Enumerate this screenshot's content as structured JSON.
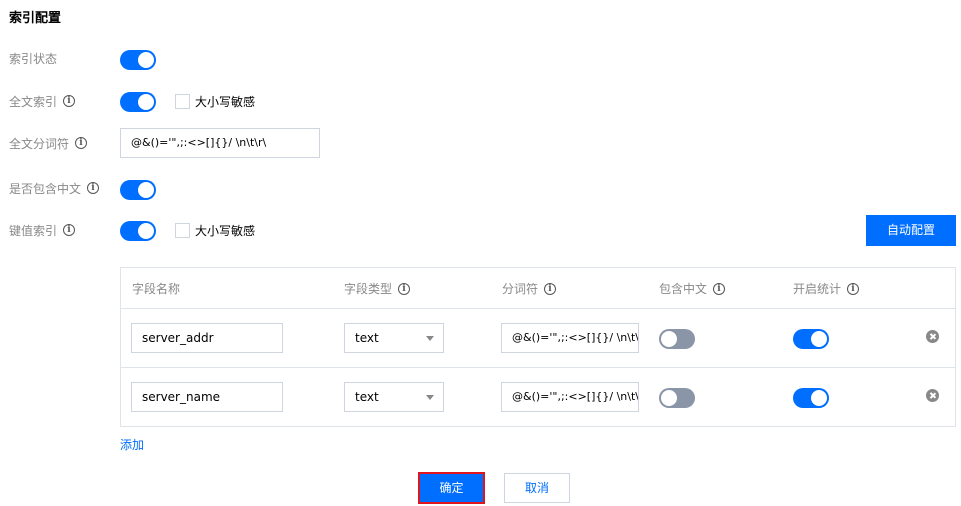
{
  "title": "索引配置",
  "form": {
    "index_status": {
      "label": "索引状态",
      "enabled": true
    },
    "fulltext_index": {
      "label": "全文索引",
      "enabled": true,
      "case_sensitive_label": "大小写敏感",
      "case_sensitive": false
    },
    "fulltext_delimiter": {
      "label": "全文分词符",
      "value": "@&()='\",;:<>[]{}/ \\n\\t\\r\\"
    },
    "include_chinese": {
      "label": "是否包含中文",
      "enabled": true
    },
    "kv_index": {
      "label": "键值索引",
      "enabled": true,
      "case_sensitive_label": "大小写敏感",
      "case_sensitive": false
    }
  },
  "auto_config_button": "自动配置",
  "table": {
    "headers": {
      "field_name": "字段名称",
      "field_type": "字段类型",
      "delimiter": "分词符",
      "include_chinese": "包含中文",
      "enable_stats": "开启统计"
    },
    "rows": [
      {
        "field_name": "server_addr",
        "field_type": "text",
        "delimiter": "@&()='\",;:<>[]{}/ \\n\\t\\r\\",
        "include_chinese": false,
        "enable_stats": true
      },
      {
        "field_name": "server_name",
        "field_type": "text",
        "delimiter": "@&()='\",;:<>[]{}/ \\n\\t\\r\\",
        "include_chinese": false,
        "enable_stats": true
      }
    ]
  },
  "add_link": "添加",
  "confirm_button": "确定",
  "cancel_button": "取消",
  "colors": {
    "primary": "#006eff",
    "toggle_off": "#8a95a7",
    "label_gray": "#888888",
    "highlight_border": "#e0151f"
  }
}
